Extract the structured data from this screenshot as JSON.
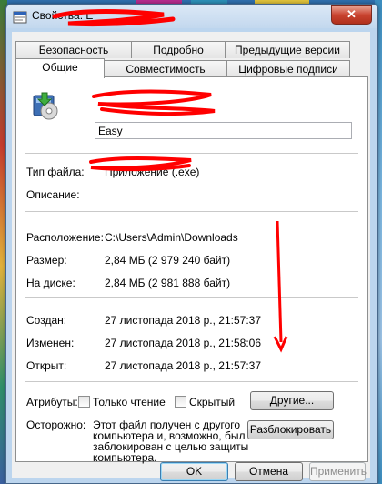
{
  "window": {
    "title": "Свойства: E",
    "close_symbol": "✕"
  },
  "tabs": {
    "row1": [
      "Безопасность",
      "Подробно",
      "Предыдущие версии"
    ],
    "row2": [
      "Общие",
      "Совместимость",
      "Цифровые подписи"
    ]
  },
  "general": {
    "file_name": "Easy",
    "file_type_label": "Тип файла:",
    "file_type_value": "Приложение (.exe)",
    "description_label": "Описание:",
    "description_value": "",
    "location_label": "Расположение:",
    "location_value": "C:\\Users\\Admin\\Downloads",
    "size_label": "Размер:",
    "size_value": "2,84 МБ (2 979 240 байт)",
    "disk_size_label": "На диске:",
    "disk_size_value": "2,84 МБ (2 981 888 байт)",
    "created_label": "Создан:",
    "created_value": "27 листопада 2018 р., 21:57:37",
    "modified_label": "Изменен:",
    "modified_value": "27 листопада 2018 р., 21:58:06",
    "accessed_label": "Открыт:",
    "accessed_value": "27 листопада 2018 р., 21:57:37",
    "attributes_label": "Атрибуты:",
    "readonly_label": "Только чтение",
    "hidden_label": "Скрытый",
    "other_button": "Другие...",
    "caution_label": "Осторожно:",
    "caution_text_1": "Этот файл получен с другого",
    "caution_text_2": "компьютера и, возможно, был",
    "caution_text_3": "заблокирован с целью защиты",
    "caution_text_4": "компьютера.",
    "unblock_button": "Разблокировать"
  },
  "footer": {
    "ok": "OK",
    "cancel": "Отмена",
    "apply": "Применить"
  },
  "colors": {
    "annotation_red": "#ff0000",
    "close_red": "#c9432f",
    "title_bar": "#c3d8ee"
  }
}
